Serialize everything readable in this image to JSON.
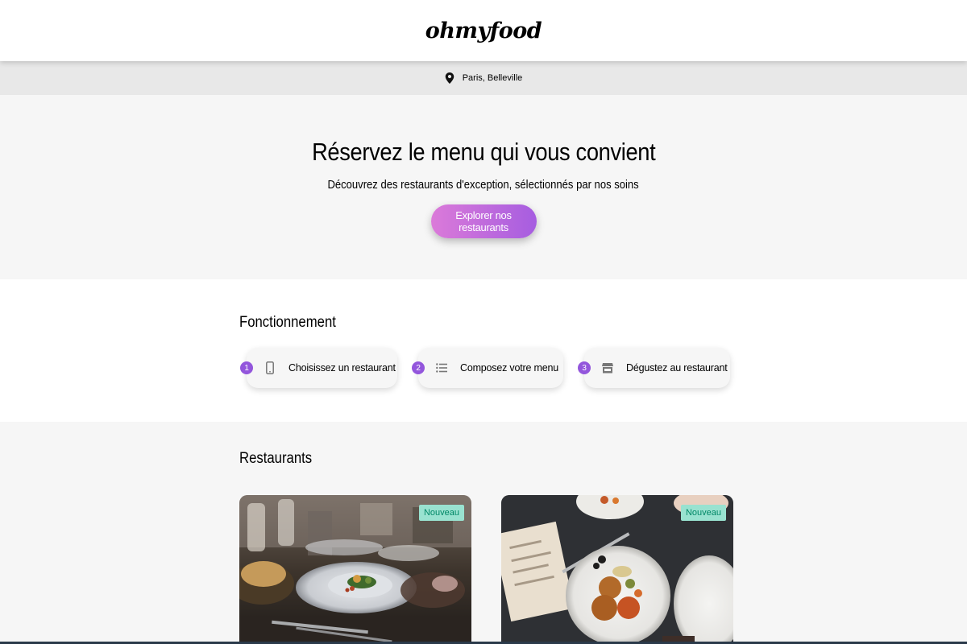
{
  "header": {
    "logo": "ohmyfood"
  },
  "location": {
    "icon": "map-pin-icon",
    "text": "Paris, Belleville"
  },
  "hero": {
    "title": "Réservez le menu qui vous convient",
    "subtitle": "Découvrez des restaurants d'exception, sélectionnés par nos soins",
    "cta_label": "Explorer nos restaurants"
  },
  "how": {
    "title": "Fonctionnement",
    "steps": [
      {
        "num": "1",
        "icon": "mobile-phone-icon",
        "label": "Choisissez un restaurant"
      },
      {
        "num": "2",
        "icon": "list-icon",
        "label": "Composez votre menu"
      },
      {
        "num": "3",
        "icon": "store-icon",
        "label": "Dégustez au restaurant"
      }
    ]
  },
  "restaurants": {
    "title": "Restaurants",
    "cards": [
      {
        "badge": "Nouveau",
        "image": "restaurant-table-dish-photo"
      },
      {
        "badge": "Nouveau",
        "image": "plated-meal-top-view-photo"
      }
    ]
  },
  "colors": {
    "accent_purple": "#9356dc",
    "cta_gradient_start": "#db7ad9",
    "cta_gradient_end": "#a65de0",
    "badge_bg": "#99e2d0",
    "badge_text": "#008766"
  }
}
